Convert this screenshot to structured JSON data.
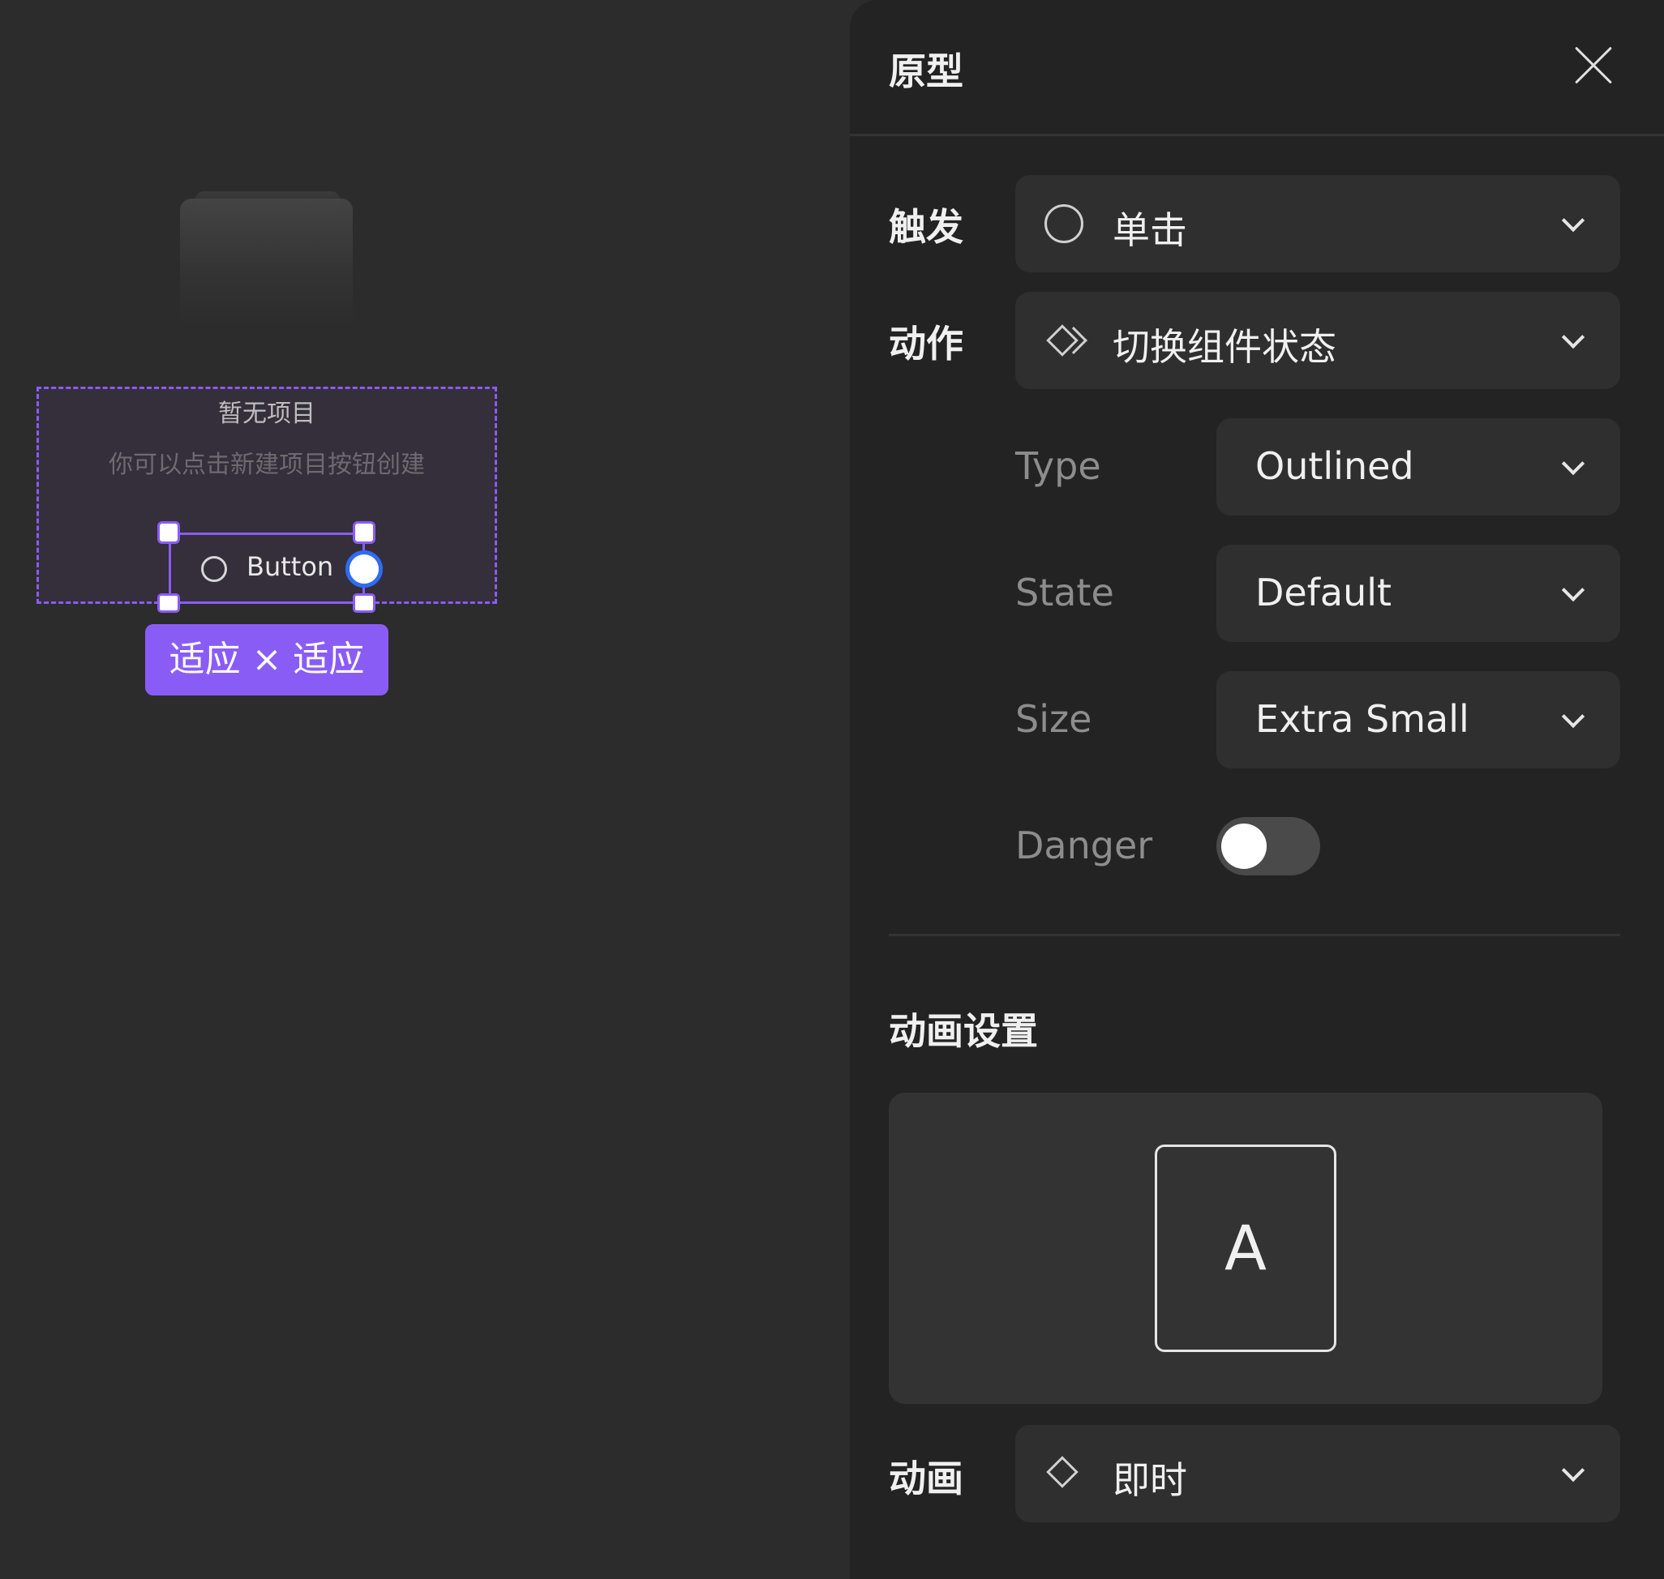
{
  "canvas": {
    "empty_title": "暂无项目",
    "empty_subtitle": "你可以点击新建项目按钮创建",
    "button_label": "Button",
    "size_tag": "适应 × 适应"
  },
  "panel": {
    "title": "原型",
    "trigger": {
      "label": "触发",
      "value": "单击",
      "icon": "circle-icon"
    },
    "action": {
      "label": "动作",
      "value": "切换组件状态",
      "icon": "component-icon"
    },
    "properties": [
      {
        "label": "Type",
        "value": "Outlined"
      },
      {
        "label": "State",
        "value": "Default"
      },
      {
        "label": "Size",
        "value": "Extra Small"
      }
    ],
    "danger": {
      "label": "Danger",
      "enabled": false
    },
    "animation_section_title": "动画设置",
    "animation_preview_letter": "A",
    "animation": {
      "label": "动画",
      "value": "即时",
      "icon": "diamond-icon"
    }
  },
  "colors": {
    "accent": "#8a5cf6",
    "connector": "#2f6cf5",
    "panel_bg": "#232323",
    "canvas_bg": "#2c2c2c"
  }
}
